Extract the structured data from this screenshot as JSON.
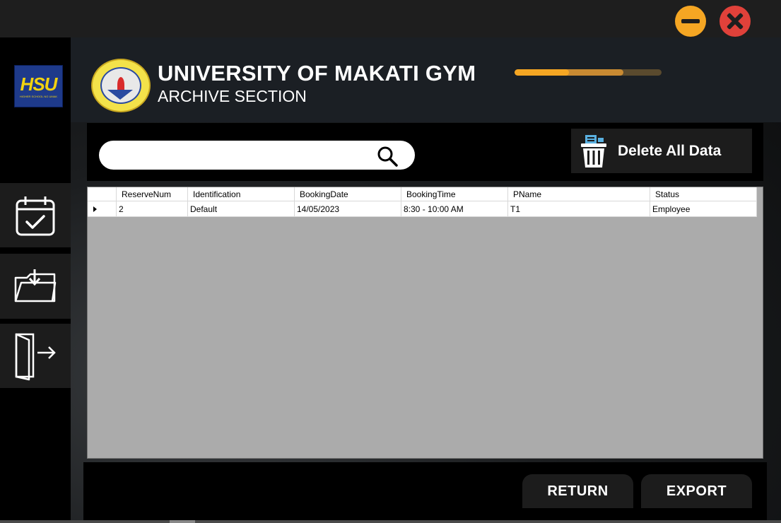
{
  "window": {
    "minimize_icon": "minimize-icon",
    "close_icon": "close-icon",
    "accent_color": "#f5a623",
    "close_color": "#e0413a"
  },
  "sidebar": {
    "logo_text": "HSU",
    "logo_subtext": "HIGHER SCHOOL NG UMAK",
    "items": [
      {
        "icon": "calendar-check-icon"
      },
      {
        "icon": "folder-download-icon"
      },
      {
        "icon": "exit-door-icon"
      }
    ]
  },
  "header": {
    "seal_text": "UNIVERSITY OF MAKATI · A.D. 1972",
    "title": "UNIVERSITY OF MAKATI GYM",
    "subtitle": "ARCHIVE SECTION",
    "progress_fraction": 0.74,
    "progress_inner_fraction": 0.37
  },
  "toolbar": {
    "search_value": "",
    "search_placeholder": "",
    "search_icon": "search-icon",
    "delete_label": "Delete All Data",
    "delete_icon": "trash-icon"
  },
  "table": {
    "columns": [
      "ReserveNum",
      "Identification",
      "BookingDate",
      "BookingTime",
      "PName",
      "Status"
    ],
    "rows": [
      [
        "2",
        "Default",
        "14/05/2023",
        "8:30 - 10:00 AM",
        "T1",
        "Employee"
      ]
    ]
  },
  "footer": {
    "return_label": "RETURN",
    "export_label": "EXPORT"
  }
}
